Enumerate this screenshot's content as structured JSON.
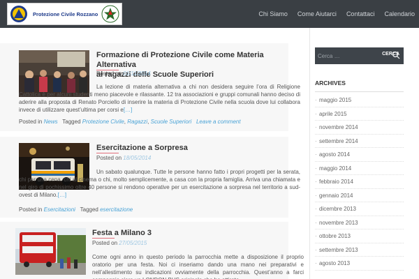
{
  "header": {
    "logo_text": "Protezione Civile Rozzano",
    "nav": [
      "Chi Siamo",
      "Come Aiutarci",
      "Contattaci",
      "Calendario"
    ]
  },
  "posts": [
    {
      "title_line1": "Formazione di Protezione Civile come Materia Alternativa",
      "title_line2": "ai ragazzi delle Scuole Superiori",
      "posted_label": "Posted on",
      "date": "01/11/2014",
      "excerpt": "La lezione di materia alternativa a chi non desidera seguire l’ora di Religione Cattolica è per alcuni studenti meno piacevole e rilassante. 12 tra associazioni e gruppi comunali hanno deciso di aderire alla proposta di Renato Porciello di inserire la materia di Protezione Civile nella scuola dove lui collabora invece di utilizzare quest’ultima per corsi e",
      "more": "[…]",
      "meta": {
        "posted_in": "Posted in",
        "category": "News",
        "tagged": "Tagged",
        "tags": [
          "Protezione Civile",
          "Ragazzi",
          "Scuole Superiori"
        ],
        "comment": "Leave a comment"
      }
    },
    {
      "title": "Esercitazione a Sorpresa",
      "posted_label": "Posted on",
      "date": "18/05/2014",
      "excerpt": "Un sabato qualunque. Tutte le persone hanno fatto i propri progetti per la serata, chi per una cena, chi al cinema o chi, molto semplicemente, a casa con la propria famiglia. Arriva una chiamata e nel giro di pochissimo oltre 40 persone si rendono operative per un esercitazione a sorpresa nel territorio a sud-ovest di Milano.",
      "more": "[…]",
      "meta": {
        "posted_in": "Posted in",
        "category": "Esercitazioni",
        "tagged": "Tagged",
        "tag": "esercitazione"
      }
    },
    {
      "title": "Festa a Milano 3",
      "posted_label": "Posted on",
      "date": "27/05/2015",
      "excerpt": "Come ogni anno in questo periodo la parrocchia mette a disposizione il proprio oratorio per una festa. Noi ci inseriamo dando una mano nei preparativi e nell’allestimento su indicazioni ovviamente della parrocchia. Quest’anno a farci compagnia c’era un LONDON BUS originale che ha attirato"
    }
  ],
  "sidebar": {
    "search_placeholder": "Cerca …",
    "search_button": "CERCA",
    "archives_title": "ARCHIVES",
    "archives": [
      "maggio 2015",
      "aprile 2015",
      "novembre 2014",
      "settembre 2014",
      "agosto 2014",
      "maggio 2014",
      "febbraio 2014",
      "gennaio 2014",
      "dicembre 2013",
      "novembre 2013",
      "ottobre 2013",
      "settembre 2013",
      "agosto 2013"
    ]
  },
  "colors": {
    "header_bg": "#3a3f44",
    "link": "#4aa3d6",
    "date": "#9ec7e2",
    "title_rule": "#e06d7a"
  }
}
